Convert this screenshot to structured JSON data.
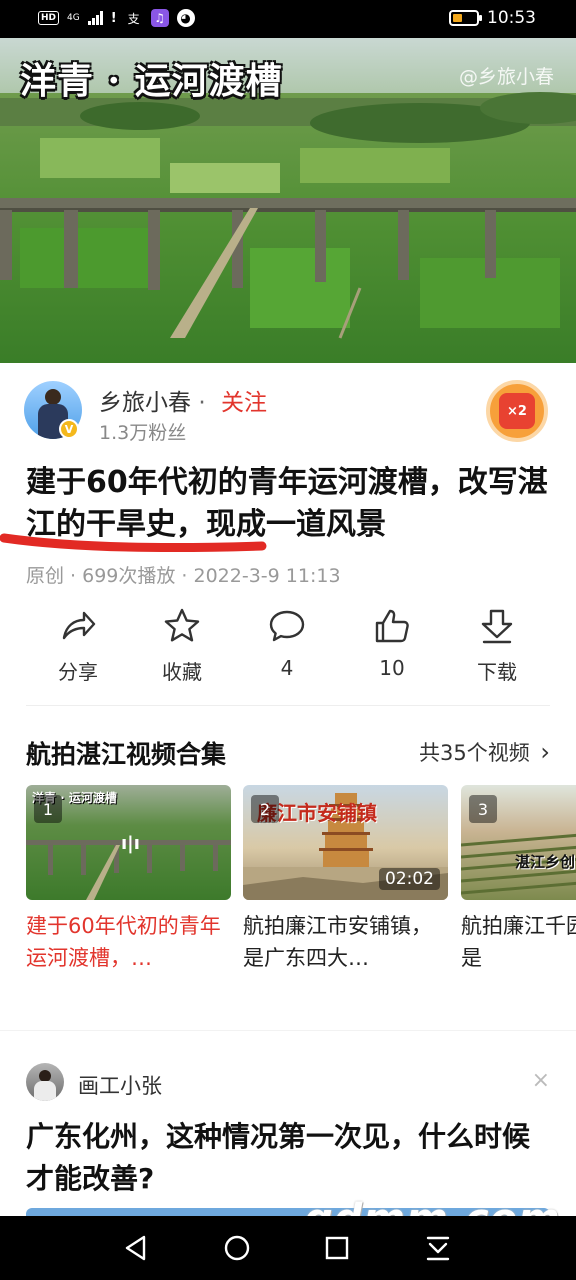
{
  "status_bar": {
    "hd": "HD",
    "network": "4G",
    "app_icon_text": "支",
    "time": "10:53",
    "battery_level": 0.35,
    "battery_color": "#f2a81d"
  },
  "video": {
    "overlay_title": "洋青 · 运河渡槽",
    "watermark": "@乡旅小春"
  },
  "author": {
    "name": "乡旅小春",
    "separator": "·",
    "follow_label": "关注",
    "fans": "1.3万粉丝",
    "verified_mark": "V",
    "reward_label": "×2"
  },
  "article": {
    "title": "建于60年代初的青年运河渡槽，改写湛江的干旱史，现成一道风景",
    "meta": "原创 · 699次播放 · 2022-3-9 11:13"
  },
  "actions": [
    {
      "icon": "share-icon",
      "label": "分享"
    },
    {
      "icon": "star-icon",
      "label": "收藏"
    },
    {
      "icon": "comment-icon",
      "label": "4"
    },
    {
      "icon": "thumb-up-icon",
      "label": "10"
    },
    {
      "icon": "download-icon",
      "label": "下载"
    }
  ],
  "collection": {
    "title": "航拍湛江视频合集",
    "count": "共35个视频",
    "chevron": "›",
    "items": [
      {
        "index": "1",
        "caption": "洋青 · 运河渡槽",
        "title": "建于60年代初的青年运河渡槽，…",
        "duration": ""
      },
      {
        "index": "2",
        "caption": "廉江市安铺镇",
        "title": "航拍廉江市安铺镇，是广东四大…",
        "duration": "02:02"
      },
      {
        "index": "3",
        "caption": "湛江乡创",
        "title": "航拍廉江千园，这里是",
        "duration": ""
      }
    ]
  },
  "next_post": {
    "author": "画工小张",
    "close": "×",
    "title": "广东化州，这种情况第一次见，什么时候才能改善?"
  },
  "site_watermark": "gdmm.com",
  "accent_red": "#e2352d"
}
